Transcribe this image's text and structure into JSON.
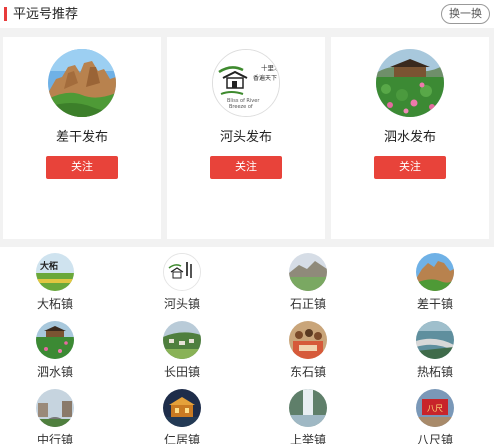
{
  "header": {
    "title": "平远号推荐",
    "refresh_label": "换一换"
  },
  "featured": [
    {
      "name": "差干发布",
      "follow_label": "关注",
      "avatar_icon": "karst-mountain-photo"
    },
    {
      "name": "河头发布",
      "follow_label": "关注",
      "avatar_icon": "house-calligraphy-logo",
      "logo_text": [
        "十里水韵",
        "香遍天下",
        "Bliss of River",
        "Breeze of"
      ]
    },
    {
      "name": "泗水发布",
      "follow_label": "关注",
      "avatar_icon": "lotus-pavilion-photo"
    }
  ],
  "towns": [
    {
      "name": "大柘镇",
      "avatar_icon": "field-calligraphy-photo",
      "avatar_text": "大柘"
    },
    {
      "name": "河头镇",
      "avatar_icon": "house-calligraphy-logo"
    },
    {
      "name": "石正镇",
      "avatar_icon": "landscape-photo"
    },
    {
      "name": "差干镇",
      "avatar_icon": "karst-mountain-photo"
    },
    {
      "name": "泗水镇",
      "avatar_icon": "lotus-pavilion-photo"
    },
    {
      "name": "长田镇",
      "avatar_icon": "village-fields-photo"
    },
    {
      "name": "东石镇",
      "avatar_icon": "crowd-photo"
    },
    {
      "name": "热柘镇",
      "avatar_icon": "highway-photo"
    },
    {
      "name": "中行镇",
      "avatar_icon": "town-street-photo"
    },
    {
      "name": "仁居镇",
      "avatar_icon": "night-building-photo"
    },
    {
      "name": "上举镇",
      "avatar_icon": "waterfall-photo"
    },
    {
      "name": "八尺镇",
      "avatar_icon": "red-sign-photo",
      "avatar_text": "八尺"
    }
  ]
}
